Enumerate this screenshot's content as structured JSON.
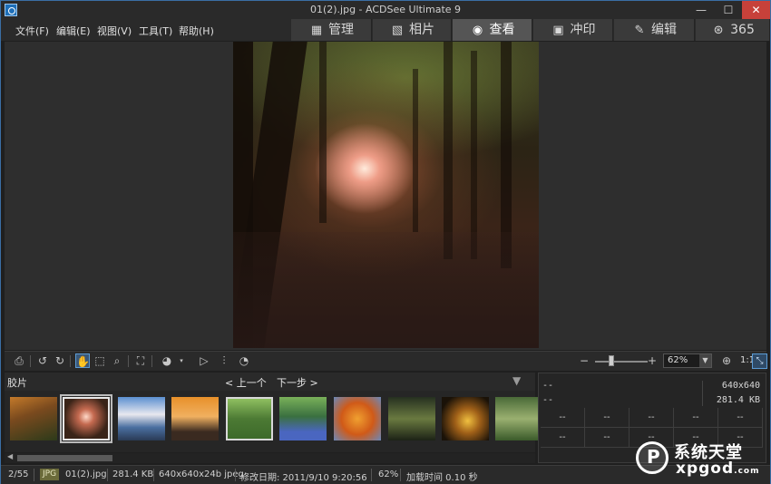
{
  "window": {
    "title": "01(2).jpg - ACDSee Ultimate 9",
    "min_glyph": "—",
    "max_glyph": "☐",
    "close_glyph": "✕"
  },
  "menu": [
    {
      "label": "文件(F)"
    },
    {
      "label": "编辑(E)"
    },
    {
      "label": "视图(V)"
    },
    {
      "label": "工具(T)"
    },
    {
      "label": "帮助(H)"
    }
  ],
  "modes": [
    {
      "label": "管理",
      "icon": "grid-icon",
      "glyph": "▦",
      "active": false
    },
    {
      "label": "相片",
      "icon": "photos-icon",
      "glyph": "▧",
      "active": false
    },
    {
      "label": "查看",
      "icon": "eye-icon",
      "glyph": "◉",
      "active": true
    },
    {
      "label": "冲印",
      "icon": "develop-icon",
      "glyph": "▣",
      "active": false
    },
    {
      "label": "编辑",
      "icon": "edit-tools-icon",
      "glyph": "✎",
      "active": false
    },
    {
      "label": "365",
      "icon": "cloud-365-icon",
      "glyph": "⊛",
      "active": false
    }
  ],
  "toolbar": {
    "zoom_value": "62%",
    "zoom_level_percent": 62,
    "zoom_dropdown_glyph": "▼",
    "ratio_label": "1:1",
    "minus_glyph": "−",
    "plus_glyph": "+",
    "fit_glyph": "⤡"
  },
  "filmstrip": {
    "title": "胶片",
    "prev_label": "< 上一个",
    "next_label": "下一步 >",
    "collapse_glyph": "▼",
    "selected_index": 1
  },
  "info_panel": {
    "row1_left": "--",
    "row1_right": "640x640",
    "row2_left": "--",
    "row2_right": "281.4 KB",
    "grid_cell": "--"
  },
  "status": {
    "position": "2/55",
    "format_badge": "JPG",
    "filename": "01(2).jpg",
    "filesize": "281.4 KB",
    "dimensions": "640x640x24b jpeg",
    "modified": "修改日期: 2011/9/10 9:20:56",
    "zoom": "62%",
    "load_time": "加载时间 0.10 秒"
  },
  "watermark": {
    "text_cn": "系统天堂",
    "text_en": "xpgod",
    "suffix": ".com"
  },
  "colors": {
    "accent_blue": "#5b9bd5",
    "close_red": "#c7413a",
    "active_tab": "#555555"
  }
}
